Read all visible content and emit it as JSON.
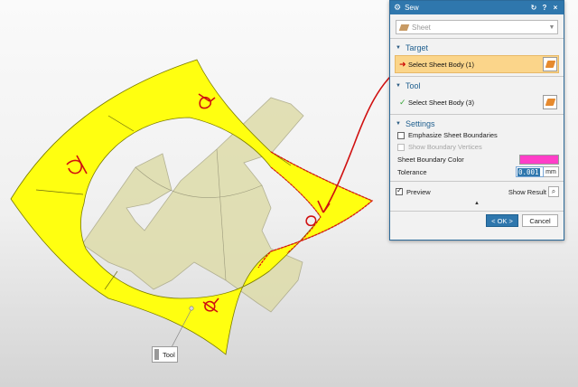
{
  "tooltip": {
    "label": "Tool"
  },
  "dialog": {
    "title": "Sew",
    "reset_icon": "reset-icon",
    "help_label": "?",
    "close_label": "×",
    "type_select": {
      "value": "Sheet",
      "icon": "sheet-type-icon"
    },
    "target": {
      "heading": "Target",
      "select_label": "Select Sheet Body (1)"
    },
    "tool": {
      "heading": "Tool",
      "select_label": "Select Sheet Body (3)"
    },
    "settings": {
      "heading": "Settings",
      "emphasize_label": "Emphasize Sheet Boundaries",
      "emphasize_checked": false,
      "show_vertices_label": "Show Boundary Vertices",
      "show_vertices_checked": false,
      "boundary_color_label": "Sheet Boundary Color",
      "boundary_color": "#ff3ec8",
      "tolerance_label": "Tolerance",
      "tolerance_value": "0.001",
      "tolerance_unit": "mm"
    },
    "preview": {
      "label": "Preview",
      "checked": true,
      "show_result_label": "Show Result"
    },
    "more_arrow": "▲",
    "ok_label": "< OK >",
    "cancel_label": "Cancel"
  },
  "colors": {
    "title_bar": "#2f77ad",
    "target_highlight": "#fbd58a",
    "sheet_yellow": "#ffff10",
    "tool_sheet": "#dedcaa",
    "annotation_red": "#e01010"
  }
}
